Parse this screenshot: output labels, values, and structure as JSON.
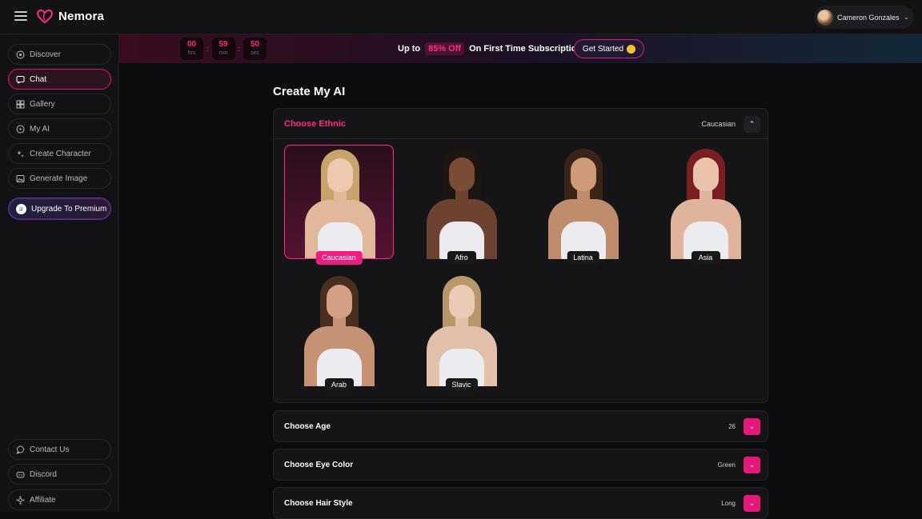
{
  "app": {
    "name": "Nemora",
    "user_name": "Cameron Gonzales"
  },
  "sidebar": {
    "items": [
      {
        "label": "Discover",
        "icon": "compass-icon"
      },
      {
        "label": "Chat",
        "icon": "chat-icon",
        "active": true
      },
      {
        "label": "Gallery",
        "icon": "grid-icon"
      },
      {
        "label": "My AI",
        "icon": "sparkle-circle-icon"
      },
      {
        "label": "Create Character",
        "icon": "sparkles-icon"
      },
      {
        "label": "Generate Image",
        "icon": "image-icon"
      }
    ],
    "premium_label": "Upgrade To Premium",
    "bottom_items": [
      {
        "label": "Contact Us",
        "icon": "message-icon"
      },
      {
        "label": "Discord",
        "icon": "discord-icon"
      },
      {
        "label": "Affiliate",
        "icon": "affiliate-icon"
      }
    ]
  },
  "banner": {
    "timer": [
      {
        "value": "00",
        "unit": "hrs"
      },
      {
        "value": "59",
        "unit": "min"
      },
      {
        "value": "50",
        "unit": "sec"
      }
    ],
    "separator": ":",
    "promo_prefix": "Up to",
    "promo_discount": "85% Off",
    "promo_suffix": "On First Time Subscription",
    "cta_label": "Get Started"
  },
  "main": {
    "title": "Create My AI",
    "ethnic_section": {
      "title": "Choose Ethnic",
      "value": "Caucasian",
      "options": [
        {
          "label": "Caucasian",
          "selected": true
        },
        {
          "label": "Afro"
        },
        {
          "label": "Latina"
        },
        {
          "label": "Asia"
        },
        {
          "label": "Arab"
        },
        {
          "label": "Slavic"
        }
      ]
    },
    "accordions": [
      {
        "title": "Choose Age",
        "value": "26"
      },
      {
        "title": "Choose Eye Color",
        "value": "Green"
      },
      {
        "title": "Choose Hair Style",
        "value": "Long"
      }
    ]
  },
  "colors": {
    "accent": "#ff2a86",
    "accent_button": "#e8177a",
    "background": "#0c0c0f",
    "panel": "#151518"
  }
}
